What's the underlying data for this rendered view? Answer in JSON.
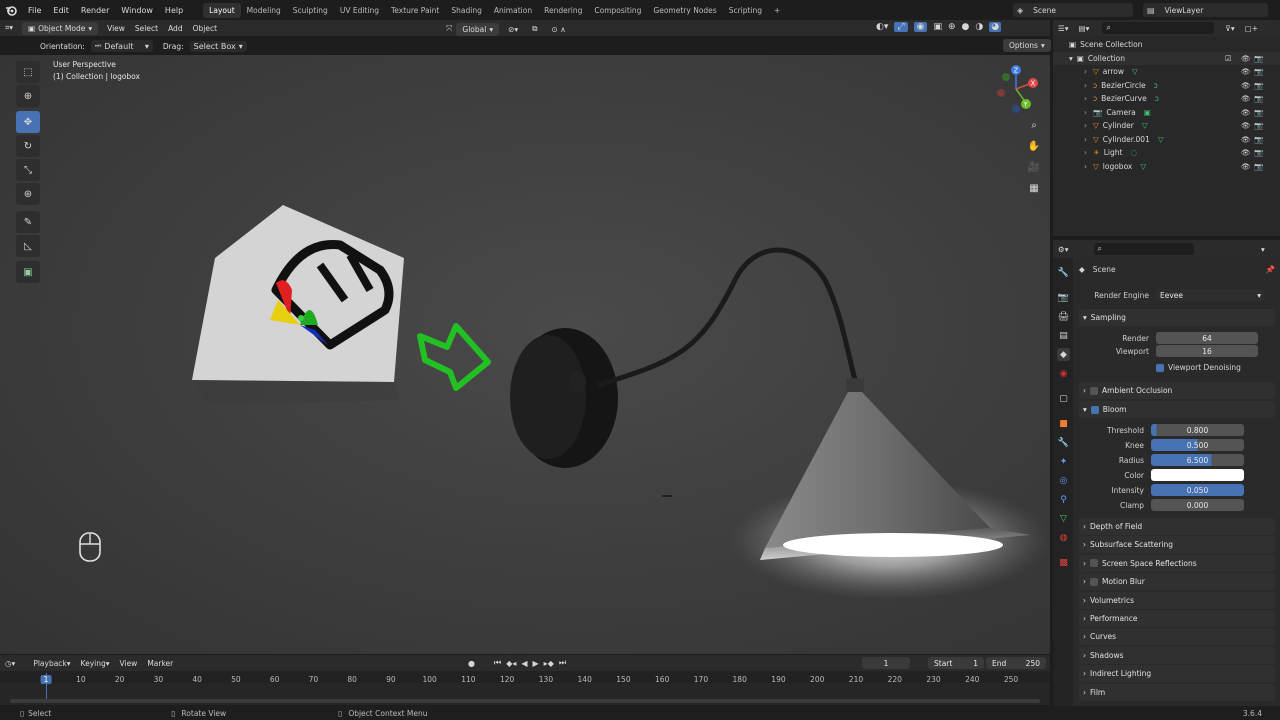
{
  "topbar": {
    "menus": [
      "File",
      "Edit",
      "Render",
      "Window",
      "Help"
    ],
    "workspaces": [
      "Layout",
      "Modeling",
      "Sculpting",
      "UV Editing",
      "Texture Paint",
      "Shading",
      "Animation",
      "Rendering",
      "Compositing",
      "Geometry Nodes",
      "Scripting"
    ],
    "active_workspace": "Layout",
    "scene": "Scene",
    "view_layer": "ViewLayer"
  },
  "viewport_header": {
    "mode": "Object Mode",
    "menus": [
      "View",
      "Select",
      "Add",
      "Object"
    ],
    "transform_orientation": "Global"
  },
  "tool_settings": {
    "orientation_label": "Orientation:",
    "orientation_value": "Default",
    "drag_label": "Drag:",
    "drag_value": "Select Box",
    "options": "Options"
  },
  "viewport": {
    "perspective": "User Perspective",
    "context": "(1) Collection | logobox"
  },
  "outliner": {
    "scene_collection": "Scene Collection",
    "collection": "Collection",
    "items": [
      {
        "name": "arrow",
        "type": "mesh"
      },
      {
        "name": "BezierCircle",
        "type": "curve"
      },
      {
        "name": "BezierCurve",
        "type": "curve"
      },
      {
        "name": "Camera",
        "type": "camera"
      },
      {
        "name": "Cylinder",
        "type": "mesh"
      },
      {
        "name": "Cylinder.001",
        "type": "mesh"
      },
      {
        "name": "Light",
        "type": "light"
      },
      {
        "name": "logobox",
        "type": "mesh"
      }
    ]
  },
  "properties": {
    "context": "Scene",
    "render_engine_label": "Render Engine",
    "render_engine": "Eevee",
    "sampling": {
      "title": "Sampling",
      "render_label": "Render",
      "render": "64",
      "viewport_label": "Viewport",
      "viewport": "16",
      "denoise_label": "Viewport Denoising"
    },
    "ambient_occlusion": "Ambient Occlusion",
    "bloom": {
      "title": "Bloom",
      "threshold_label": "Threshold",
      "threshold": "0.800",
      "knee_label": "Knee",
      "knee": "0.500",
      "radius_label": "Radius",
      "radius": "6.500",
      "color_label": "Color",
      "intensity_label": "Intensity",
      "intensity": "0.050",
      "clamp_label": "Clamp",
      "clamp": "0.000"
    },
    "panels": [
      "Depth of Field",
      "Subsurface Scattering",
      "Screen Space Reflections",
      "Motion Blur",
      "Volumetrics",
      "Performance",
      "Curves",
      "Shadows",
      "Indirect Lighting",
      "Film"
    ]
  },
  "timeline": {
    "menus": [
      "Playback",
      "Keying",
      "View",
      "Marker"
    ],
    "current_frame": "1",
    "start_label": "Start",
    "start": "1",
    "end_label": "End",
    "end": "250",
    "ticks": [
      "1",
      "10",
      "20",
      "30",
      "40",
      "50",
      "60",
      "70",
      "80",
      "90",
      "100",
      "110",
      "120",
      "130",
      "140",
      "150",
      "160",
      "170",
      "180",
      "190",
      "200",
      "210",
      "220",
      "230",
      "240",
      "250"
    ]
  },
  "statusbar": {
    "select": "Select",
    "rotate": "Rotate View",
    "context_menu": "Object Context Menu",
    "version": "3.6.4"
  },
  "colors": {
    "accent": "#4772b3",
    "arrow_green": "#22c022",
    "bloom_color": "#ffffff"
  }
}
